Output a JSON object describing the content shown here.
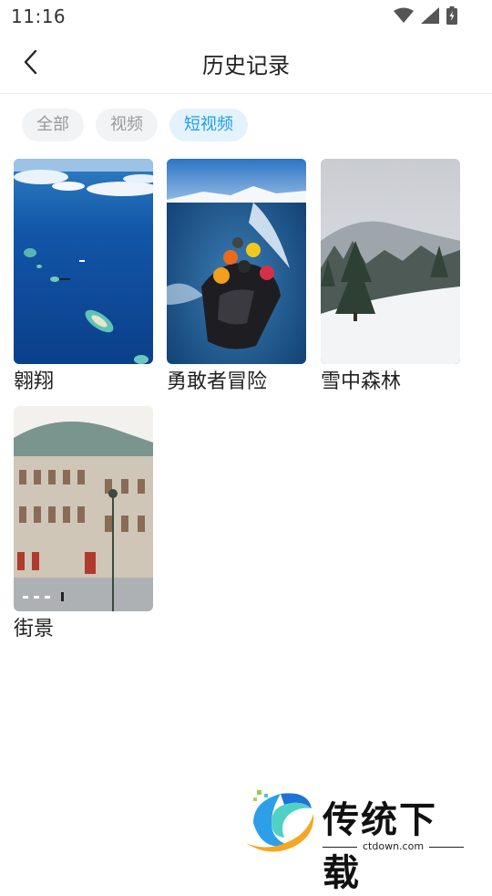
{
  "status": {
    "time": "11:16"
  },
  "header": {
    "title": "历史记录"
  },
  "tabs": [
    {
      "label": "全部",
      "active": false
    },
    {
      "label": "视频",
      "active": false
    },
    {
      "label": "短视频",
      "active": true
    }
  ],
  "items": [
    {
      "title": "翱翔",
      "thumb": "aerial-ocean-islands"
    },
    {
      "title": "勇敢者冒险",
      "thumb": "speedboat-glacier"
    },
    {
      "title": "雪中森林",
      "thumb": "snowy-forest"
    },
    {
      "title": "街景",
      "thumb": "opera-house-street"
    }
  ],
  "watermark": {
    "brand": "传统下载",
    "domain": "ctdown.com"
  },
  "colors": {
    "accent": "#1ea0e6",
    "tab_active_bg": "#e3f2fd",
    "tab_bg": "#f2f3f5"
  }
}
